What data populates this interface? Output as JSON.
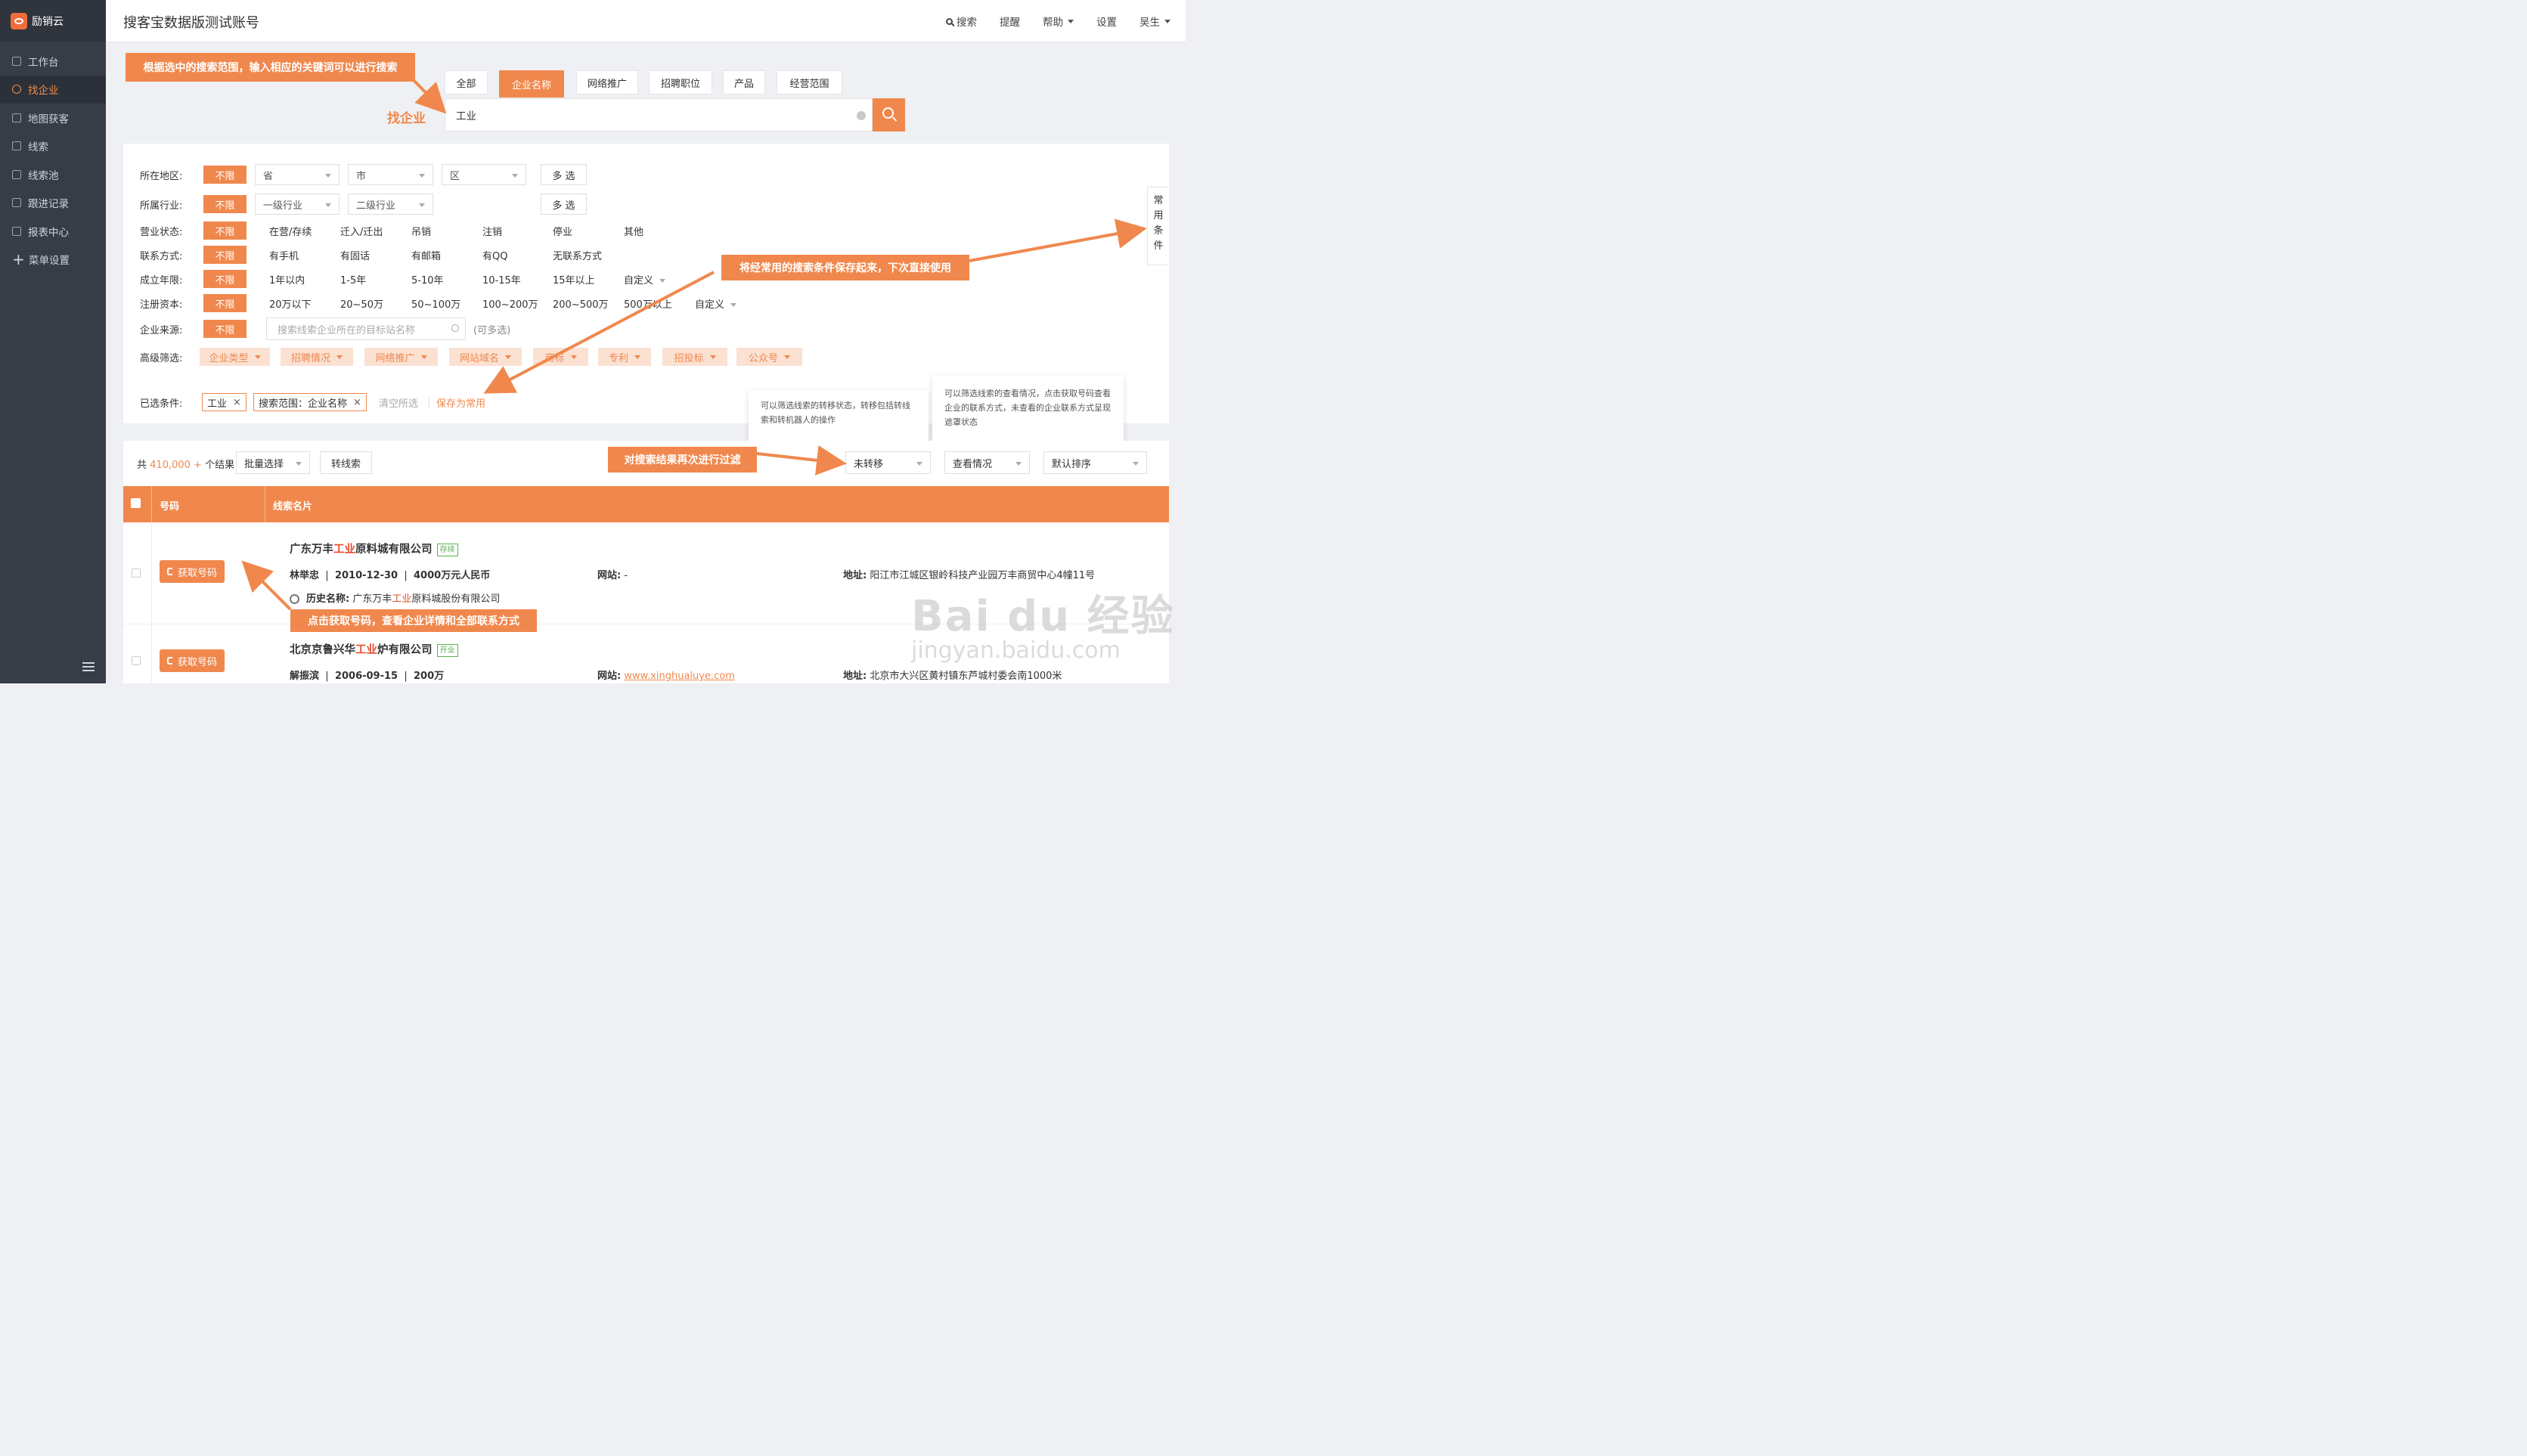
{
  "brand": "励销云",
  "sidebar": {
    "items": [
      {
        "label": "工作台",
        "icon": "monitor-icon"
      },
      {
        "label": "找企业",
        "icon": "search-icon"
      },
      {
        "label": "地图获客",
        "icon": "map-icon"
      },
      {
        "label": "线索",
        "icon": "clue-icon"
      },
      {
        "label": "线索池",
        "icon": "pool-icon"
      },
      {
        "label": "跟进记录",
        "icon": "record-icon"
      },
      {
        "label": "报表中心",
        "icon": "chart-icon"
      },
      {
        "label": "菜单设置",
        "icon": "plus-icon"
      }
    ]
  },
  "header": {
    "account": "搜客宝数据版测试账号",
    "search": "搜索",
    "remind": "提醒",
    "help": "帮助",
    "settings": "设置",
    "user": "吴生"
  },
  "search": {
    "label": "找企业",
    "tabs": [
      "全部",
      "企业名称",
      "网络推广",
      "招聘职位",
      "产品",
      "经营范围"
    ],
    "value": "工业"
  },
  "callouts": {
    "search_tip": "根据选中的搜索范围，输入相应的关键词可以进行搜索",
    "save_tip": "将经常用的搜索条件保存起来，下次直接使用",
    "filter_tip": "对搜索结果再次进行过滤",
    "get_tip": "点击获取号码，查看企业详情和全部联系方式"
  },
  "filters": {
    "unlimited": "不限",
    "multi": "多 选",
    "region": {
      "label": "所在地区:",
      "province": "省",
      "city": "市",
      "district": "区"
    },
    "industry": {
      "label": "所属行业:",
      "level1": "一级行业",
      "level2": "二级行业"
    },
    "status": {
      "label": "营业状态:",
      "options": [
        "在营/存续",
        "迁入/迁出",
        "吊销",
        "注销",
        "停业",
        "其他"
      ]
    },
    "contact": {
      "label": "联系方式:",
      "options": [
        "有手机",
        "有固话",
        "有邮箱",
        "有QQ",
        "无联系方式"
      ]
    },
    "years": {
      "label": "成立年限:",
      "options": [
        "1年以内",
        "1-5年",
        "5-10年",
        "10-15年",
        "15年以上",
        "自定义"
      ]
    },
    "capital": {
      "label": "注册资本:",
      "options": [
        "20万以下",
        "20~50万",
        "50~100万",
        "100~200万",
        "200~500万",
        "500万以上",
        "自定义"
      ]
    },
    "source": {
      "label": "企业来源:",
      "placeholder": "搜索线索企业所在的目标站名称",
      "hint": "(可多选)"
    },
    "advanced": {
      "label": "高级筛选:",
      "options": [
        "企业类型",
        "招聘情况",
        "网络推广",
        "网站域名",
        "商标",
        "专利",
        "招投标",
        "公众号"
      ]
    },
    "selected": {
      "label": "已选条件:",
      "chips": [
        "工业",
        "搜索范围：企业名称"
      ],
      "clear": "清空所选",
      "save": "保存为常用"
    },
    "common": [
      "常",
      "用",
      "条",
      "件"
    ]
  },
  "tooltips": {
    "transfer": "可以筛选线索的转移状态，转移包括转线索和转机器人的操作",
    "view": "可以筛选线索的查看情况，点击获取号码查看企业的联系方式，未查看的企业联系方式呈现遮罩状态"
  },
  "results": {
    "count_prefix": "共",
    "count": "410,000 +",
    "count_suffix": "个结果",
    "batch": "批量选择",
    "to_clue": "转线索",
    "transfer_filter": "未转移",
    "view_filter": "查看情况",
    "sort": "默认排序",
    "col_number": "号码",
    "col_card": "线索名片",
    "get_number": "获取号码",
    "rows": [
      {
        "name_pre": "广东万丰",
        "name_hl": "工业",
        "name_post": "原料城有限公司",
        "badge": "存续",
        "person": "林举忠",
        "date": "2010-12-30",
        "capital": "4000万元人民币",
        "site_label": "网站:",
        "site": "-",
        "addr_label": "地址:",
        "addr": "阳江市江城区银岭科技产业园万丰商贸中心4幢11号",
        "hist_label": "历史名称:",
        "hist_pre": "广东万丰",
        "hist_hl": "工业",
        "hist_post": "原料城股份有限公司"
      },
      {
        "name_pre": "北京京鲁兴华",
        "name_hl": "工业",
        "name_post": "炉有限公司",
        "badge": "开业",
        "person": "解振滨",
        "date": "2006-09-15",
        "capital": "200万",
        "site_label": "网站:",
        "site": "www.xinghualuye.com",
        "addr_label": "地址:",
        "addr": "北京市大兴区黄村镇东芦城村委会南1000米"
      }
    ]
  },
  "watermark": {
    "line1": "Bai du 经验",
    "line2": "jingyan.baidu.com"
  },
  "colors": {
    "accent": "#f0884d",
    "sidebar": "#373d47",
    "highlight": "#e94b2d"
  }
}
